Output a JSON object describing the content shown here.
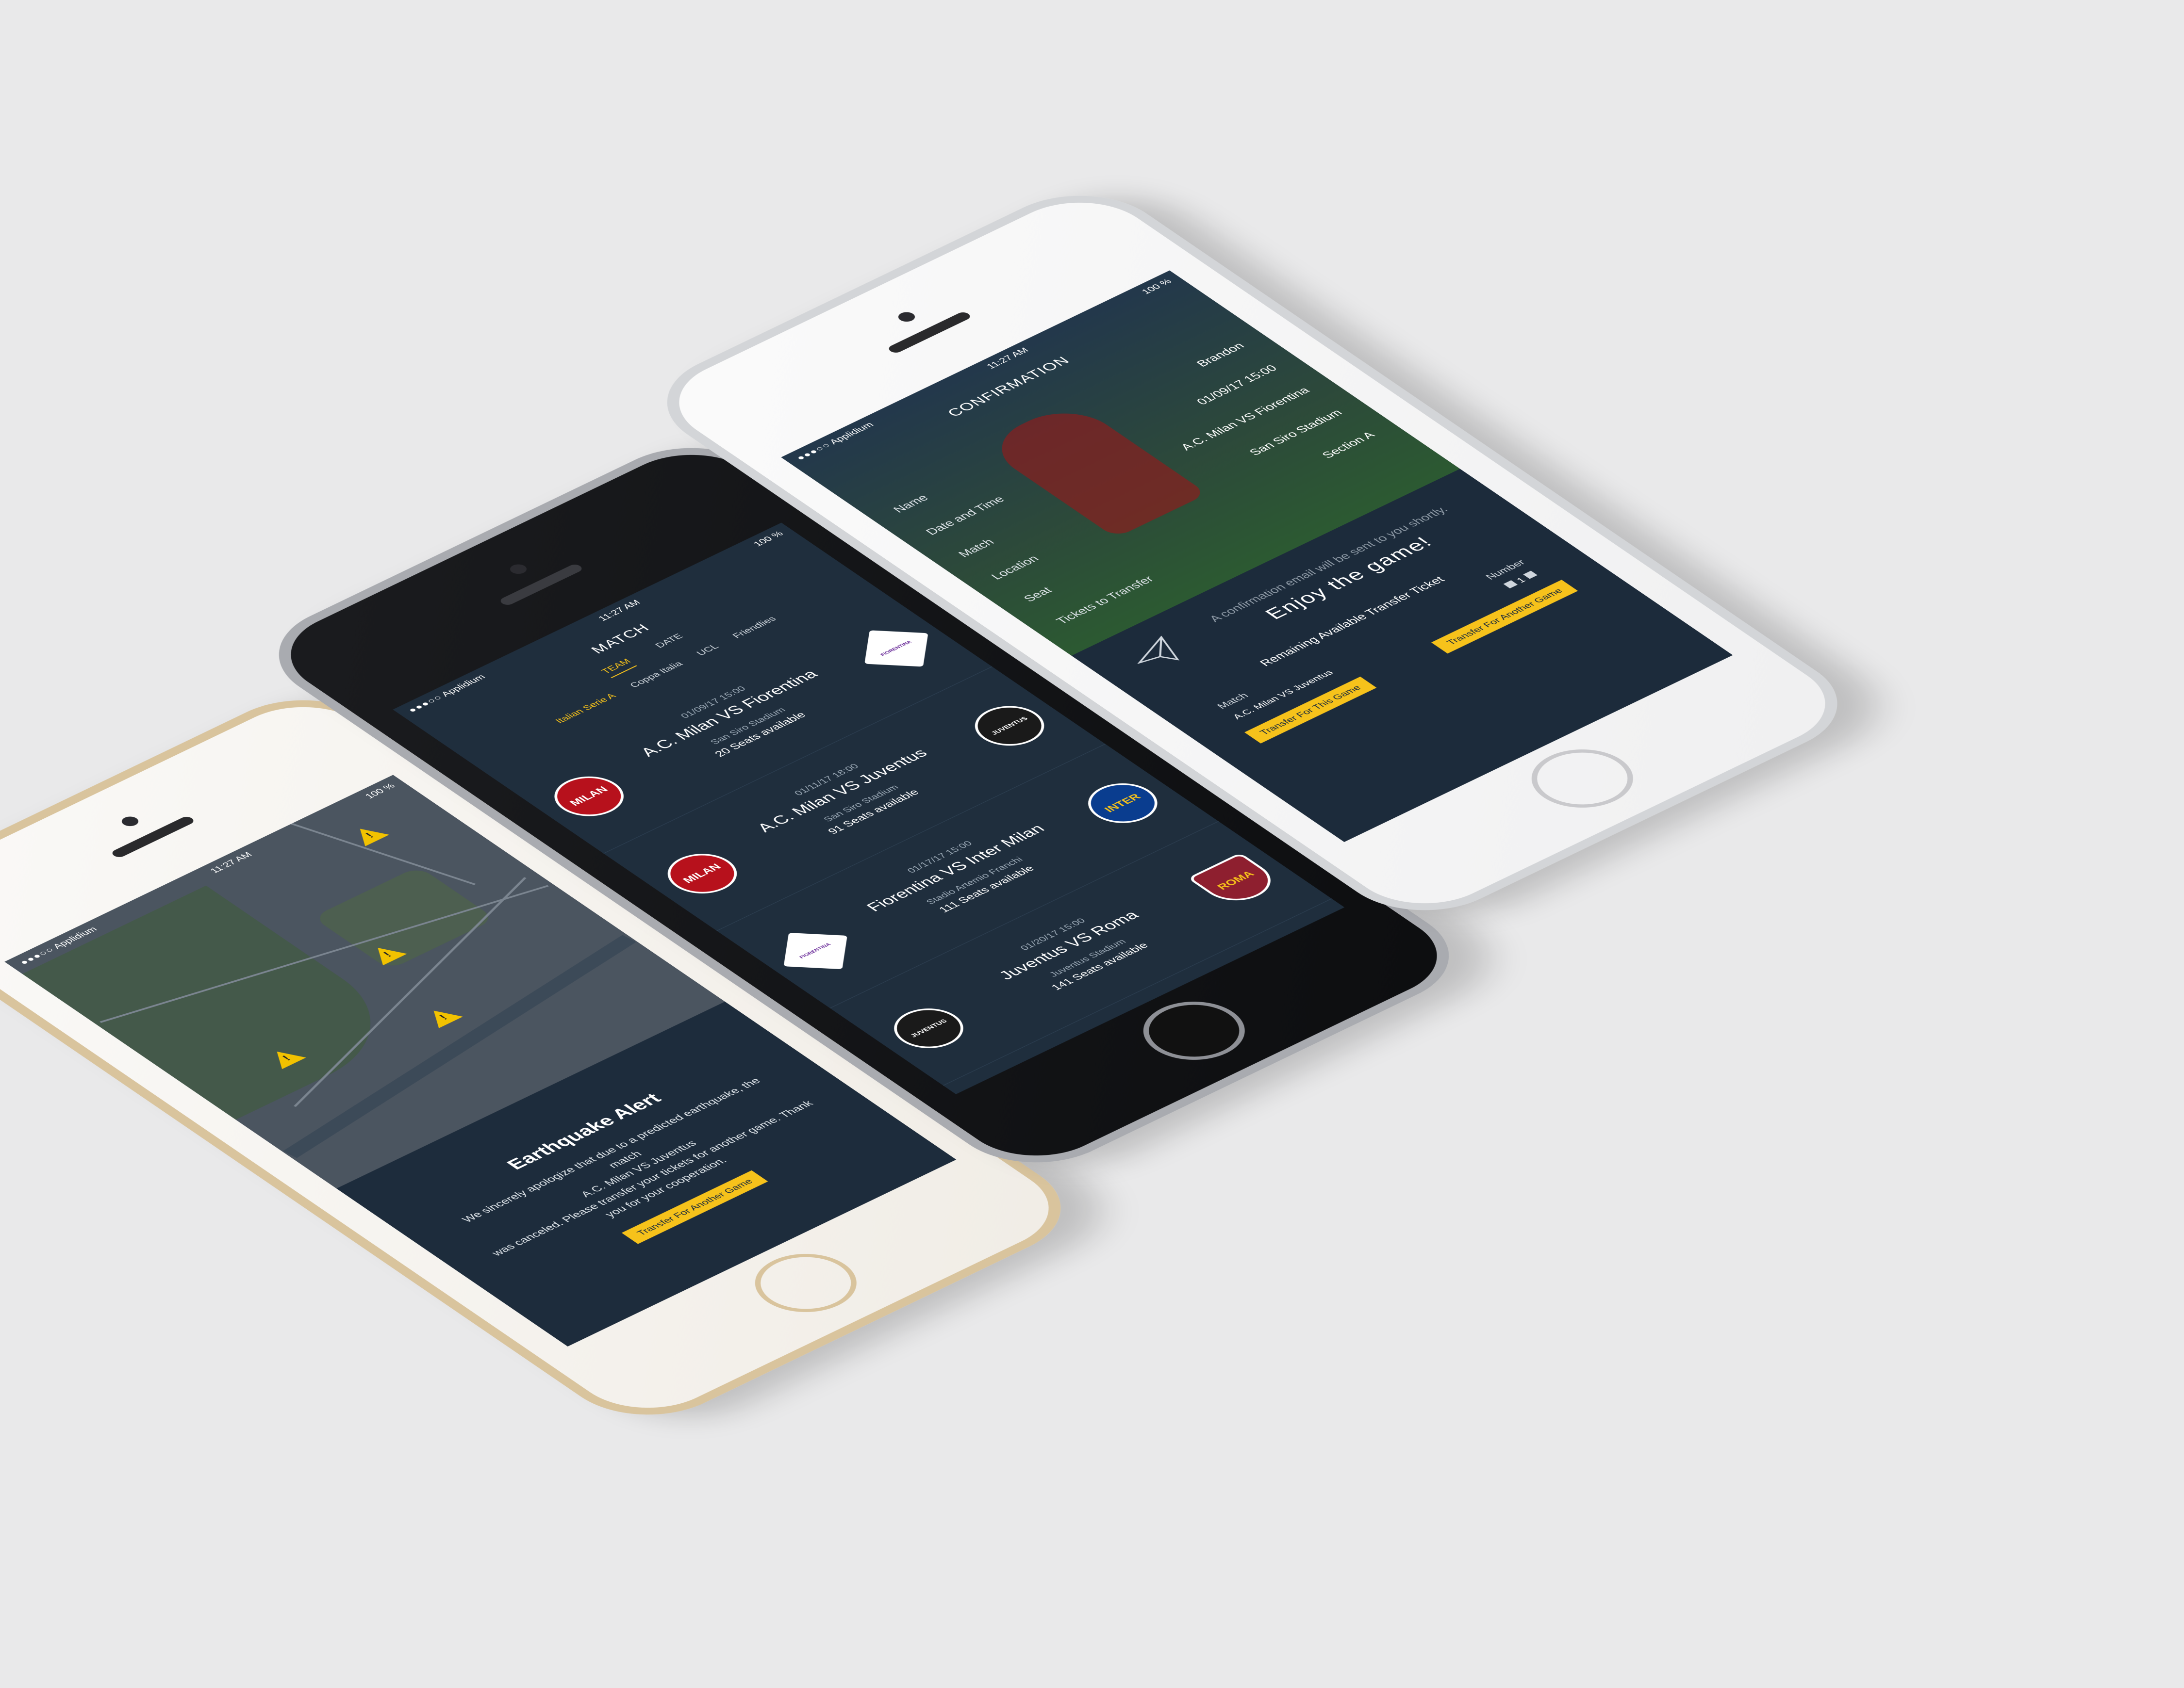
{
  "status_bar": {
    "carrier": "Applidium",
    "time": "11:27 AM",
    "battery": "100 %",
    "signal": "●●●○○"
  },
  "alert_screen": {
    "title": "Earthquake Alert",
    "body_1": "We sincerely apologize that due to a predicted earthquake, the match",
    "body_2": "A.C. Milan VS Juventus",
    "body_3": "was canceled. Please transfer your tickets for another game. Thank you for your cooperation.",
    "button": "Transfer For Another Game"
  },
  "match_screen": {
    "title": "MATCH",
    "filters": [
      "TEAM",
      "DATE"
    ],
    "leagues": [
      "Italian Serie A",
      "Coppa Italia",
      "UCL",
      "Friendlies"
    ],
    "matches": [
      {
        "date": "01/09/17 15:00",
        "title": "A.C. Milan VS Fiorentina",
        "stadium": "San Siro Stadium",
        "seats": "20 Seats available",
        "home": "MILAN",
        "away": "FIORENTINA"
      },
      {
        "date": "01/11/17 18:00",
        "title": "A.C. Milan VS Juventus",
        "stadium": "San Siro Stadium",
        "seats": "91 Seats available",
        "home": "MILAN",
        "away": "JUVENTUS"
      },
      {
        "date": "01/17/17 15:00",
        "title": "Fiorentina VS Inter Milan",
        "stadium": "Stadio Artemio Franchi",
        "seats": "111 Seats available",
        "home": "FIORENTINA",
        "away": "INTER"
      },
      {
        "date": "01/20/17 15:00",
        "title": "Juventus VS Roma",
        "stadium": "Juventus Stadium",
        "seats": "141 Seats available",
        "home": "JUVENTUS",
        "away": "ROMA"
      }
    ]
  },
  "confirm_screen": {
    "title": "CONFIRMATION",
    "rows": [
      {
        "k": "Name",
        "v": "Brandon"
      },
      {
        "k": "Date and Time",
        "v": "01/09/17 15:00"
      },
      {
        "k": "Match",
        "v": "A.C. Milan VS Fiorentina"
      },
      {
        "k": "Location",
        "v": "San Siro Stadium"
      },
      {
        "k": "Seat",
        "v": "Section A"
      },
      {
        "k": "Tickets to Transfer",
        "v": ""
      }
    ],
    "note": "A confirmation email will be sent to you shortly.",
    "enjoy": "Enjoy the game!",
    "remaining_head": "Remaining Available Transfer Ticket",
    "col_match": "Match",
    "col_number": "Number",
    "remaining_match": "A.C. Milan VS Juventus",
    "remaining_number": "1",
    "btn_this": "Transfer For This Game",
    "btn_another": "Transfer For Another Game"
  }
}
